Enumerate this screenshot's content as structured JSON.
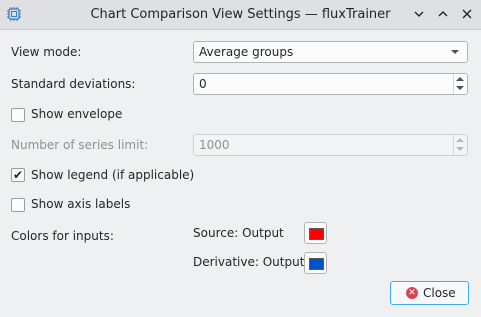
{
  "window": {
    "title": "Chart Comparison View Settings — fluxTrainer",
    "icons": [
      "app-chip-icon",
      "chevron-down-icon",
      "chevron-up-icon",
      "close-icon"
    ]
  },
  "form": {
    "view_mode_label": "View mode:",
    "view_mode_value": "Average groups",
    "std_dev_label": "Standard deviations:",
    "std_dev_value": "0",
    "show_envelope_label": "Show envelope",
    "show_envelope_checked": false,
    "series_limit_label": "Number of series limit:",
    "series_limit_value": "1000",
    "show_legend_label": "Show legend (if applicable)",
    "show_legend_checked": true,
    "show_axis_labels_label": "Show axis labels",
    "show_axis_labels_checked": false,
    "colors_label": "Colors for inputs:",
    "colors": [
      {
        "name": "Source: Output",
        "color": "#ff0000"
      },
      {
        "name": "Derivative: Output",
        "color": "#0050c8"
      }
    ]
  },
  "buttons": {
    "close_label": "Close"
  }
}
